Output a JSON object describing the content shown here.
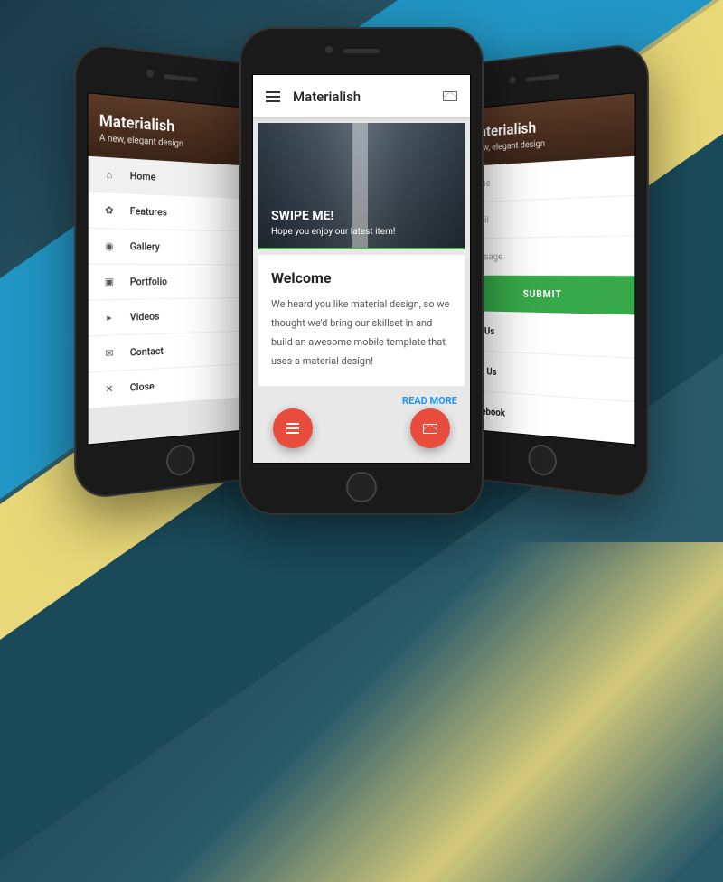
{
  "app": {
    "name": "Materialish",
    "tagline": "A new, elegant design"
  },
  "menu": {
    "items": [
      {
        "label": "Home",
        "icon": "home",
        "active": true
      },
      {
        "label": "Features",
        "icon": "gear",
        "active": false
      },
      {
        "label": "Gallery",
        "icon": "camera",
        "active": false
      },
      {
        "label": "Portfolio",
        "icon": "image",
        "active": false
      },
      {
        "label": "Videos",
        "icon": "play",
        "active": false
      },
      {
        "label": "Contact",
        "icon": "mail",
        "active": false
      },
      {
        "label": "Close",
        "icon": "close",
        "active": false
      }
    ]
  },
  "form": {
    "fields": {
      "name": "Name",
      "email": "Email",
      "message": "Message"
    },
    "submit": "SUBMIT",
    "contacts": [
      "Call Us",
      "Text Us",
      "Facebook"
    ]
  },
  "hero": {
    "title": "SWIPE ME!",
    "subtitle": "Hope you enjoy our latest item!"
  },
  "welcome": {
    "heading": "Welcome",
    "body": "We heard you like material design, so we thought we'd bring our skillset in and build an awesome mobile template that uses a material design!",
    "read_more": "READ MORE"
  }
}
